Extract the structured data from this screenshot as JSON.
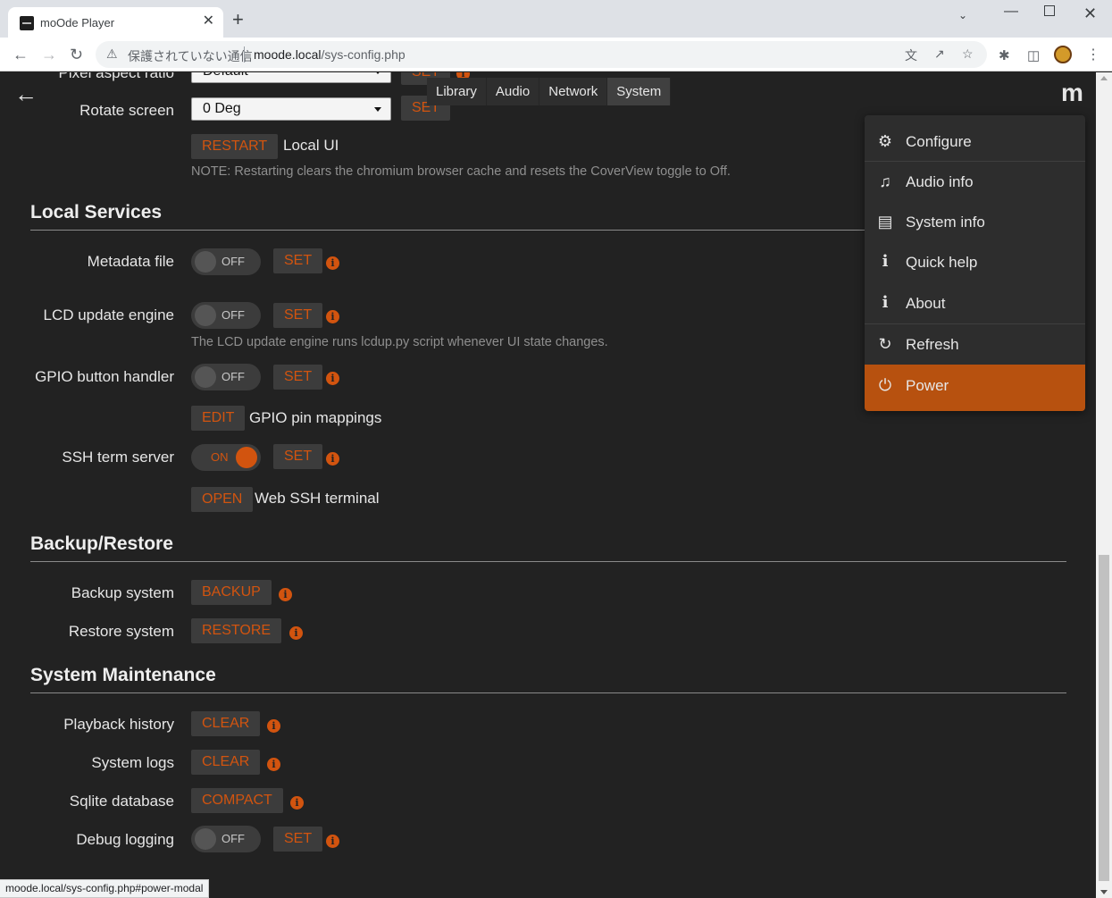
{
  "browser": {
    "tab_title": "moOde Player",
    "tab_close": "✕",
    "new_tab": "+",
    "not_secure": "保護されていない通信",
    "url_host": "moode.local",
    "url_path": "/sys-config.php",
    "status_url": "moode.local/sys-config.php#power-modal"
  },
  "header": {
    "back": "←",
    "logo": "m",
    "tabs": [
      "Library",
      "Audio",
      "Network",
      "System"
    ],
    "active_tab": "System"
  },
  "local_display": {
    "pixel_aspect_label": "Pixel aspect ratio",
    "pixel_aspect_value": "Default",
    "rotate_label": "Rotate screen",
    "rotate_value": "0 Deg",
    "set_label": "SET",
    "restart_label": "RESTART",
    "restart_desc": "Local UI",
    "note": "NOTE: Restarting clears the chromium browser cache and resets the CoverView toggle to Off."
  },
  "local_services": {
    "title": "Local Services",
    "metadata_label": "Metadata file",
    "metadata_state": "OFF",
    "lcd_label": "LCD update engine",
    "lcd_state": "OFF",
    "lcd_note": "The LCD update engine runs lcdup.py script whenever UI state changes.",
    "gpio_label": "GPIO button handler",
    "gpio_state": "OFF",
    "edit_label": "EDIT",
    "gpio_desc": "GPIO pin mappings",
    "ssh_label": "SSH term server",
    "ssh_state": "ON",
    "open_label": "OPEN",
    "ssh_desc": "Web SSH terminal",
    "set_label": "SET"
  },
  "backup": {
    "title": "Backup/Restore",
    "backup_label": "Backup system",
    "backup_btn": "BACKUP",
    "restore_label": "Restore system",
    "restore_btn": "RESTORE"
  },
  "maintenance": {
    "title": "System Maintenance",
    "playback_label": "Playback history",
    "clear_btn": "CLEAR",
    "logs_label": "System logs",
    "sqlite_label": "Sqlite database",
    "compact_btn": "COMPACT",
    "debug_label": "Debug logging",
    "debug_state": "OFF",
    "set_label": "SET"
  },
  "menu": {
    "items": [
      {
        "label": "Configure",
        "icon": "gear-icon"
      },
      {
        "label": "Audio info",
        "icon": "music-note-icon"
      },
      {
        "label": "System info",
        "icon": "document-icon"
      },
      {
        "label": "Quick help",
        "icon": "info-icon"
      },
      {
        "label": "About",
        "icon": "info-icon"
      },
      {
        "label": "Refresh",
        "icon": "refresh-icon"
      },
      {
        "label": "Power",
        "icon": "power-icon"
      }
    ]
  },
  "colors": {
    "accent": "#d2540f",
    "power_bg": "#b7510f",
    "page_bg": "#222222"
  }
}
